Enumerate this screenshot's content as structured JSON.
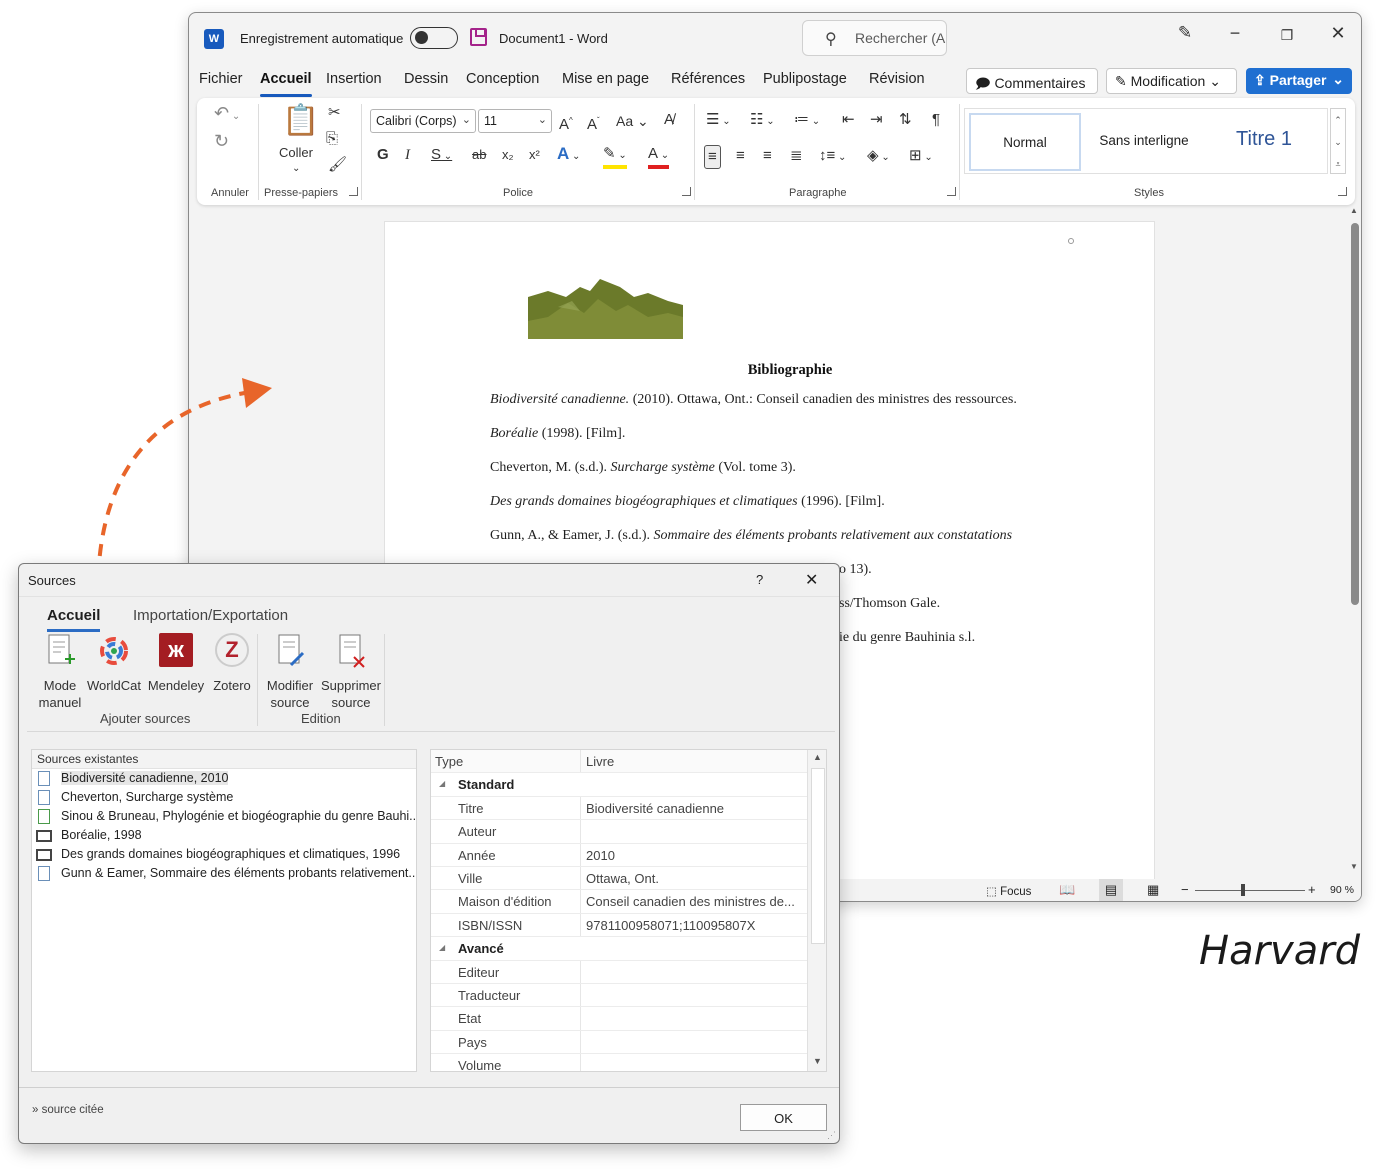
{
  "word": {
    "autosave_label": "Enregistrement automatique",
    "doc_title": "Document1 - Word",
    "search_placeholder": "Rechercher (A",
    "menu": [
      "Fichier",
      "Accueil",
      "Insertion",
      "Dessin",
      "Conception",
      "Mise en page",
      "Références",
      "Publipostage",
      "Révision"
    ],
    "active_menu": "Accueil",
    "comments_label": "Commentaires",
    "modification_label": "Modification",
    "share_label": "Partager",
    "ribbon": {
      "undo_group": "Annuler",
      "clipboard_group": "Presse-papiers",
      "paste_label": "Coller",
      "font_group": "Police",
      "font_name": "Calibri (Corps)",
      "font_size": "11",
      "paragraph_group": "Paragraphe",
      "styles_group": "Styles",
      "styles": [
        "Normal",
        "Sans interligne",
        "Titre 1"
      ],
      "bold": "G",
      "italic": "I",
      "underline": "S",
      "strike": "ab",
      "sub": "x₂",
      "sup": "x²",
      "case": "Aa"
    },
    "document": {
      "heading": "Bibliographie",
      "entries": [
        {
          "italic": "Biodiversité canadienne.",
          "rest": " (2010). Ottawa, Ont.: Conseil canadien des ministres des ressources."
        },
        {
          "italic": "Boréalie",
          "rest": " (1998). [Film]."
        },
        {
          "pre": "Cheverton, M. (s.d.). ",
          "italic": "Surcharge système",
          "rest": " (Vol. tome 3)."
        },
        {
          "italic": "Des grands domaines biogéographiques et climatiques",
          "rest": " (1996). [Film]."
        },
        {
          "pre": "Gunn, A., & Eamer, J. (s.d.). ",
          "italic": "Sommaire des éléments probants relativement aux constatations"
        }
      ],
      "fragments": [
        "o 13).",
        "ss/Thomson Gale.",
        "ie du genre Bauhinia s.l."
      ]
    },
    "status": {
      "focus": "Focus",
      "zoom": "90 %"
    }
  },
  "dialog": {
    "title": "Sources",
    "help": "?",
    "tabs": [
      "Accueil",
      "Importation/Exportation"
    ],
    "tools": [
      {
        "label1": "Mode",
        "label2": "manuel",
        "icon": "manual-source-icon"
      },
      {
        "label1": "WorldCat",
        "label2": "",
        "icon": "worldcat-icon"
      },
      {
        "label1": "Mendeley",
        "label2": "",
        "icon": "mendeley-icon"
      },
      {
        "label1": "Zotero",
        "label2": "",
        "icon": "zotero-icon"
      },
      {
        "label1": "Modifier",
        "label2": "source",
        "icon": "edit-source-icon"
      },
      {
        "label1": "Supprimer",
        "label2": "source",
        "icon": "delete-source-icon"
      }
    ],
    "group_add": "Ajouter sources",
    "group_edit": "Edition",
    "list_header": "Sources existantes",
    "sources": [
      {
        "text": "Biodiversité canadienne, 2010",
        "type": "book"
      },
      {
        "text": "Cheverton, Surcharge système",
        "type": "book"
      },
      {
        "text": "Sinou & Bruneau, Phylogénie et biogéographie du genre Bauhi...",
        "type": "web"
      },
      {
        "text": "Boréalie, 1998",
        "type": "film"
      },
      {
        "text": "Des grands domaines biogéographiques et climatiques, 1996",
        "type": "film"
      },
      {
        "text": "Gunn & Eamer, Sommaire des éléments probants relativement...",
        "type": "book"
      }
    ],
    "properties": {
      "type_label": "Type",
      "type_value": "Livre",
      "section_standard": "Standard",
      "standard": [
        {
          "k": "Titre",
          "v": "Biodiversité canadienne"
        },
        {
          "k": "Auteur",
          "v": ""
        },
        {
          "k": "Année",
          "v": "2010"
        },
        {
          "k": "Ville",
          "v": "Ottawa, Ont."
        },
        {
          "k": "Maison d'édition",
          "v": "Conseil canadien des ministres de..."
        },
        {
          "k": "ISBN/ISSN",
          "v": "9781100958071;110095807X"
        }
      ],
      "section_advanced": "Avancé",
      "advanced": [
        {
          "k": "Editeur",
          "v": ""
        },
        {
          "k": "Traducteur",
          "v": ""
        },
        {
          "k": "Etat",
          "v": ""
        },
        {
          "k": "Pays",
          "v": ""
        },
        {
          "k": "Volume",
          "v": ""
        }
      ]
    },
    "footer_note": "» source citée",
    "ok_label": "OK"
  },
  "caption": "Harvard",
  "colors": {
    "accent": "#185abd",
    "share": "#1f6fd1",
    "arrow": "#e8652a"
  }
}
